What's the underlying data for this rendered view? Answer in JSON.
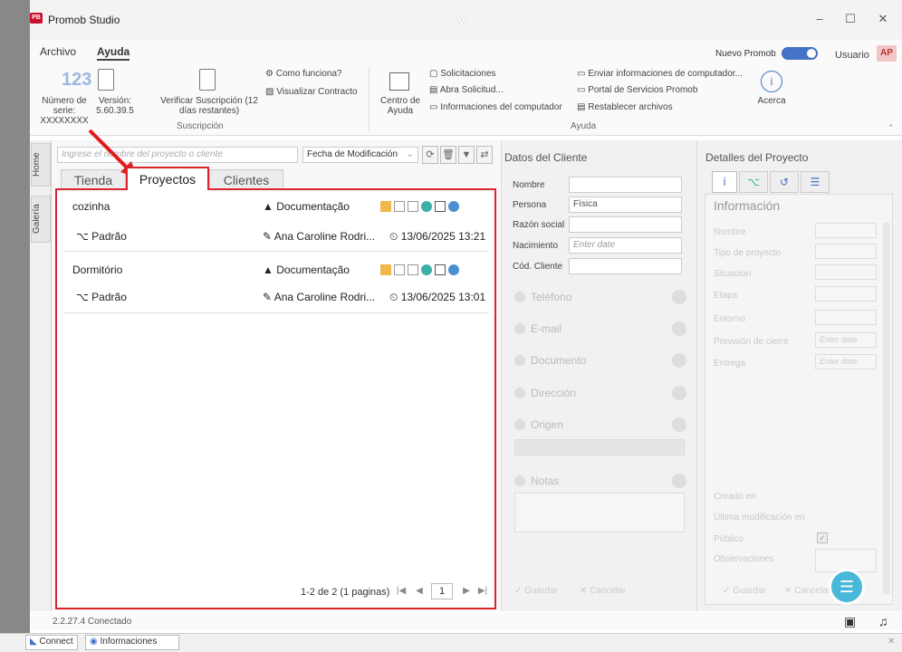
{
  "window": {
    "title": "Promob Studio",
    "center_mark": "V",
    "app_icon_text": "PB"
  },
  "menu": {
    "file": "Archivo",
    "help": "Ayuda"
  },
  "header_right": {
    "new_promob": "Nuevo Promob",
    "user": "Usuario",
    "avatar": "AP"
  },
  "ribbon": {
    "serial_icon": "123",
    "serial_label": "Número de serie:",
    "serial_value": "XXXXXXXX",
    "version_label": "Versión:",
    "version_value": "5.60.39.5",
    "verify_label": "Verificar Suscripción (12",
    "verify_label2": "días restantes)",
    "how_works": "Como funciona?",
    "view_contract": "Visualizar Contracto",
    "subscription_group": "Suscripción",
    "help_center": "Centro de",
    "help_center2": "Ayuda",
    "requests": "Solicitaciones",
    "open_request": "Abra Solicitud...",
    "computer_info": "Informaciones del computador",
    "send_info": "Enviar informaciones de computador...",
    "services_portal": "Portal de Servicios Promob",
    "restore_files": "Restablecer archivos",
    "help_group": "Ayuda",
    "about": "Acerca"
  },
  "sidebar": {
    "home": "Home",
    "gallery": "Galería"
  },
  "filters": {
    "search_placeholder": "Ingrese el nombre del proyecto o cliente",
    "sort": "Fecha de Modificación"
  },
  "tabs": [
    "Tienda",
    "Proyectos",
    "Clientes"
  ],
  "projects": [
    {
      "name": "cozinha",
      "doc": "Documentação",
      "env": "Padrão",
      "author": "Ana Caroline Rodri...",
      "date": "13/06/2025 13:21"
    },
    {
      "name": "Dormitório",
      "doc": "Documentação",
      "env": "Padrão",
      "author": "Ana Caroline Rodri...",
      "date": "13/06/2025 13:01"
    }
  ],
  "pager": {
    "text": "1-2 de 2 (1 paginas)",
    "page": "1"
  },
  "client": {
    "title": "Datos del Cliente",
    "name": "Nombre",
    "person": "Persona",
    "person_value": "Física",
    "company": "Razón social",
    "birth": "Nacimiento",
    "birth_ph": "Enter date",
    "code": "Cód. Cliente",
    "phone": "Teléfono",
    "email": "E-mail",
    "document": "Documento",
    "address": "Dirección",
    "origin": "Origen",
    "notes": "Notas",
    "save": "Guardar",
    "cancel": "Cancelar"
  },
  "details": {
    "title": "Detalles del Proyecto",
    "info": "Información",
    "name": "Nombre",
    "type": "Tipo de proyecto",
    "status": "Situación",
    "stage": "Etapa",
    "env": "Entorno",
    "closing": "Previsión de cierre",
    "delivery": "Entrega",
    "date_ph": "Enter date",
    "created": "Creado en",
    "modified": "Última modificación en",
    "public": "Público",
    "notes": "Observaciones",
    "save": "Guardar",
    "cancel": "Cancelar"
  },
  "status": {
    "text": "2.2.27.4 Conectado"
  },
  "taskbar": {
    "connect": "Connect",
    "info": "Informaciones"
  }
}
